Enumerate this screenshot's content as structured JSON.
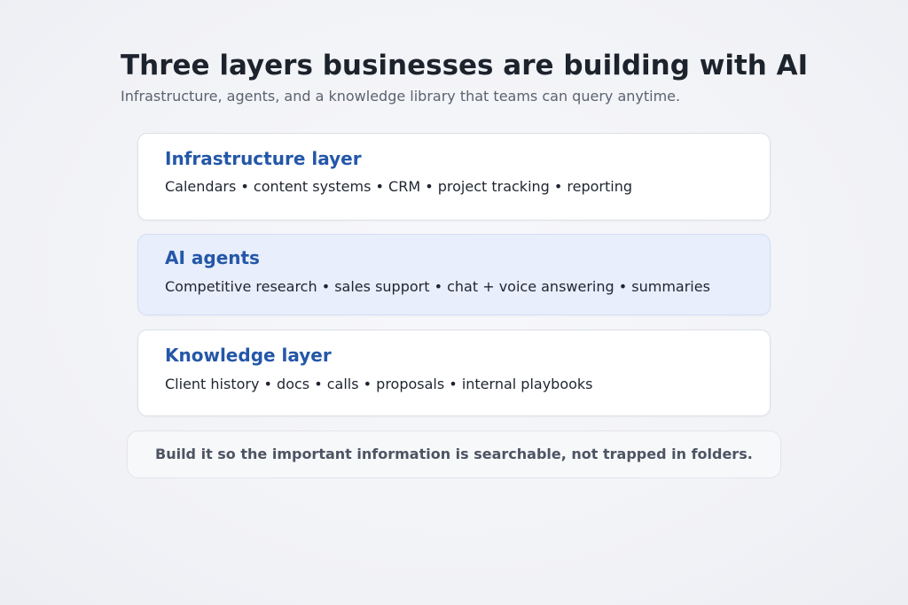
{
  "header": {
    "title": "Three layers businesses are building with AI",
    "subtitle": "Infrastructure, agents, and a knowledge library that teams can query anytime."
  },
  "layers": [
    {
      "title": "Infrastructure layer",
      "items": "Calendars • content systems • CRM • project tracking • reporting"
    },
    {
      "title": "AI agents",
      "items": "Competitive research • sales support • chat + voice answering • summaries"
    },
    {
      "title": "Knowledge layer",
      "items": "Client history • docs • calls • proposals • internal playbooks"
    }
  ],
  "footer_note": "Build it so the important information is searchable, not trapped in folders.",
  "colors": {
    "accent": "#2457a8",
    "highlight_card": "#e8eefb",
    "text_dark": "#1d232d",
    "text_muted": "#5b6270"
  }
}
